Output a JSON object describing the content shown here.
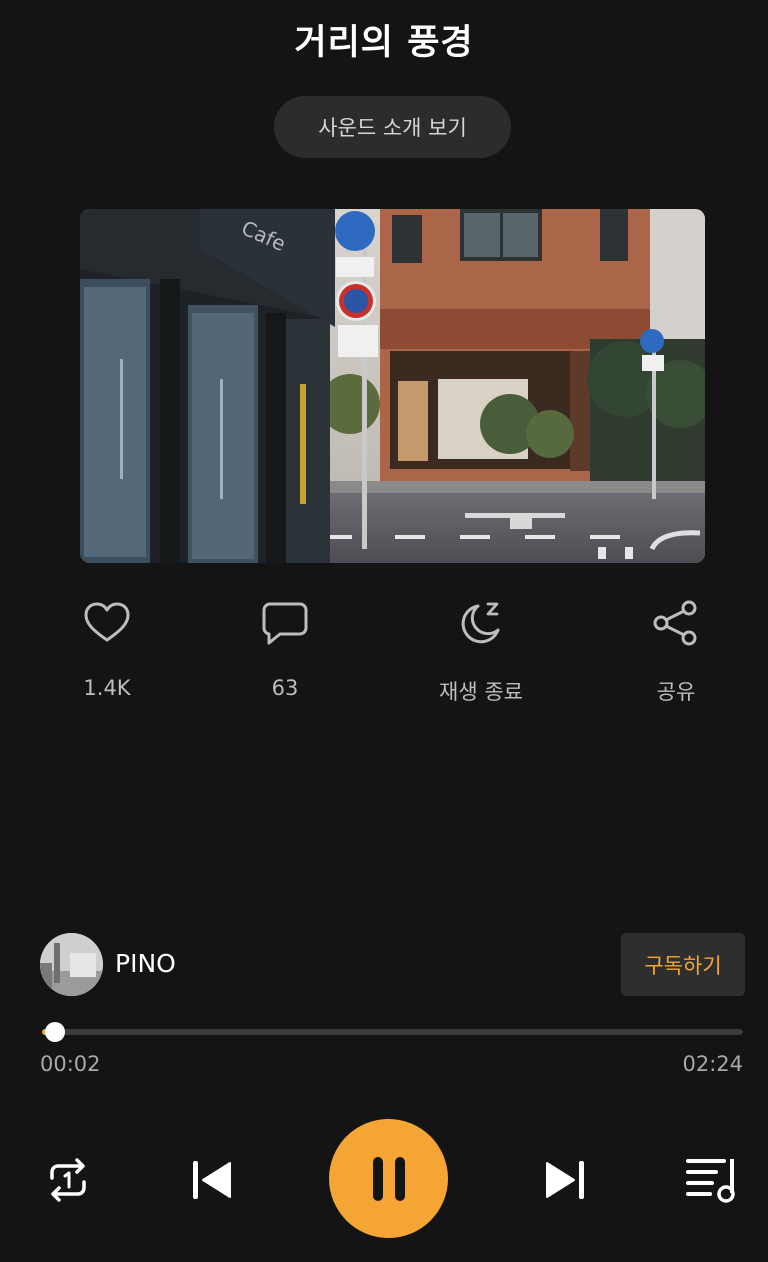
{
  "header": {
    "title": "거리의 풍경",
    "intro_button": "사운드 소개 보기"
  },
  "artwork": {
    "alt": "street scene"
  },
  "actions": [
    {
      "id": "like",
      "icon": "heart-icon",
      "label": "1.4K"
    },
    {
      "id": "comment",
      "icon": "comment-icon",
      "label": "63"
    },
    {
      "id": "sleep",
      "icon": "moon-sleep-icon",
      "label": "재생 종료"
    },
    {
      "id": "share",
      "icon": "share-icon",
      "label": "공유"
    }
  ],
  "artist": {
    "name": "PINO",
    "subscribe_label": "구독하기"
  },
  "player": {
    "current_time": "00:02",
    "total_time": "02:24",
    "progress": 0.014,
    "state": "playing"
  },
  "colors": {
    "accent": "#f5a534",
    "background": "#141414"
  }
}
